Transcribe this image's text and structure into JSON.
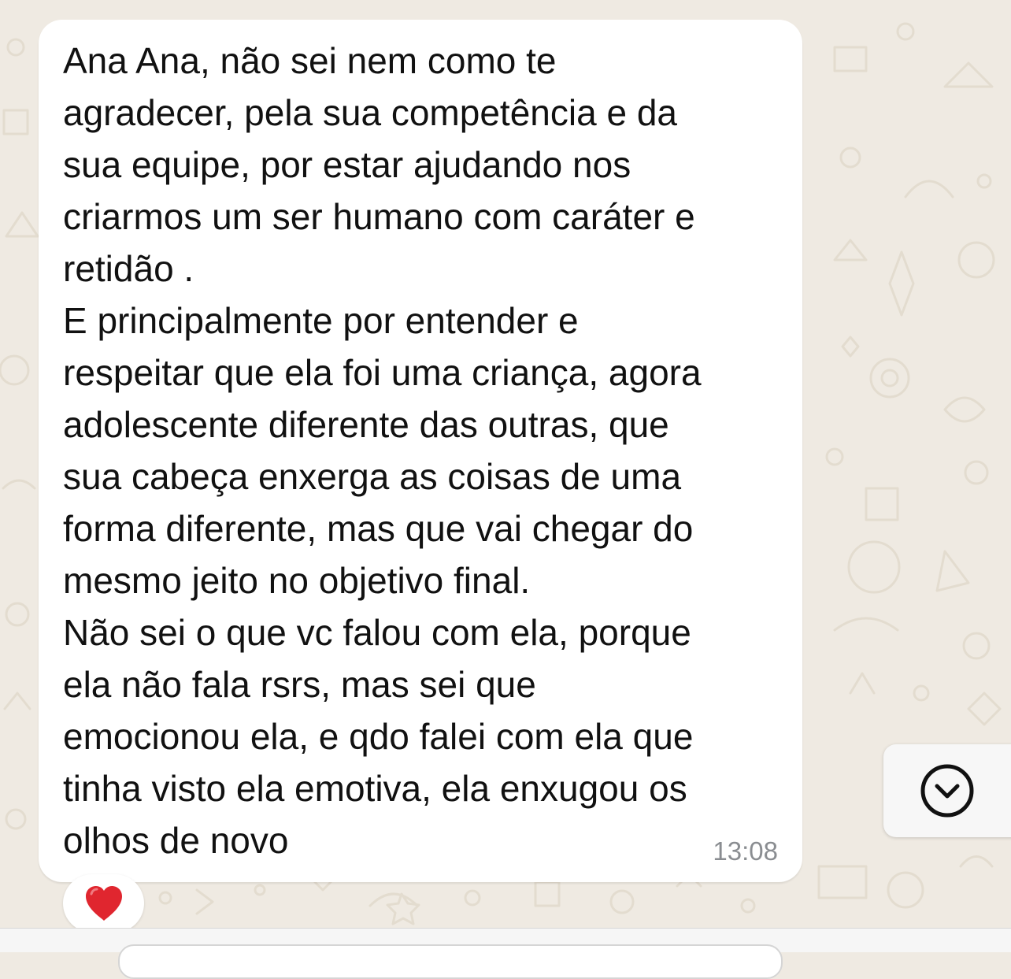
{
  "chat": {
    "message": {
      "lines": [
        "Ana Ana, não sei nem como te",
        "agradecer, pela sua competência e da",
        "sua equipe, por estar ajudando nos",
        "criarmos um ser humano com caráter e",
        "retidão .",
        "E principalmente por entender e",
        "respeitar que ela foi uma criança, agora",
        "adolescente diferente das outras, que",
        "sua cabeça enxerga as coisas de uma",
        "forma diferente, mas que vai chegar do",
        "mesmo jeito no objetivo final.",
        "Não sei o que vc falou com ela, porque",
        "ela não fala rsrs, mas sei que",
        "emocionou ela, e qdo falei com ela que",
        "tinha visto ela emotiva, ela enxugou os",
        "olhos de novo"
      ],
      "time": "13:08",
      "reaction": "heart-icon"
    },
    "scroll_button": {
      "icon": "chevron-down-icon"
    }
  },
  "colors": {
    "wallpaper": "#efeae2",
    "bubble": "#ffffff",
    "text": "#111111",
    "timestamp": "#8a8d91",
    "heart": "#e0262f"
  }
}
